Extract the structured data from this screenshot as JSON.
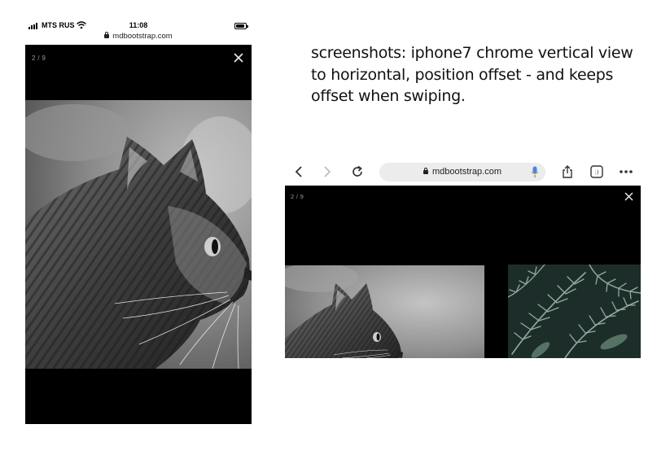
{
  "phone": {
    "status_bar": {
      "carrier": "MTS RUS",
      "time": "11:08"
    },
    "url": "mdbootstrap.com",
    "lightbox": {
      "counter": "2 / 9",
      "image": "black-and-white cat profile photo"
    }
  },
  "description": {
    "lines": [
      "screenshots: iphone7 chrome vertical view",
      "to horizontal, position offset - and keeps",
      "offset when swiping."
    ]
  },
  "landscape": {
    "toolbar": {
      "url": "mdbootstrap.com",
      "icons": [
        "back-icon",
        "forward-icon",
        "reload-icon",
        "lock-icon",
        "microphone-icon",
        "share-icon",
        "tabs-icon",
        "more-icon"
      ],
      "tabs_badge": ":)"
    },
    "lightbox": {
      "counter": "2 / 9",
      "images": [
        "black-and-white cat photo (offset)",
        "green fern leaves photo (next slide)"
      ]
    }
  },
  "colors": {
    "lightbox_bg": "#000000",
    "url_pill_bg": "#ececed",
    "mic_blue": "#4285f4",
    "fern_dark": "#1d2e2a",
    "fern_leaf": "#8fae9a"
  }
}
